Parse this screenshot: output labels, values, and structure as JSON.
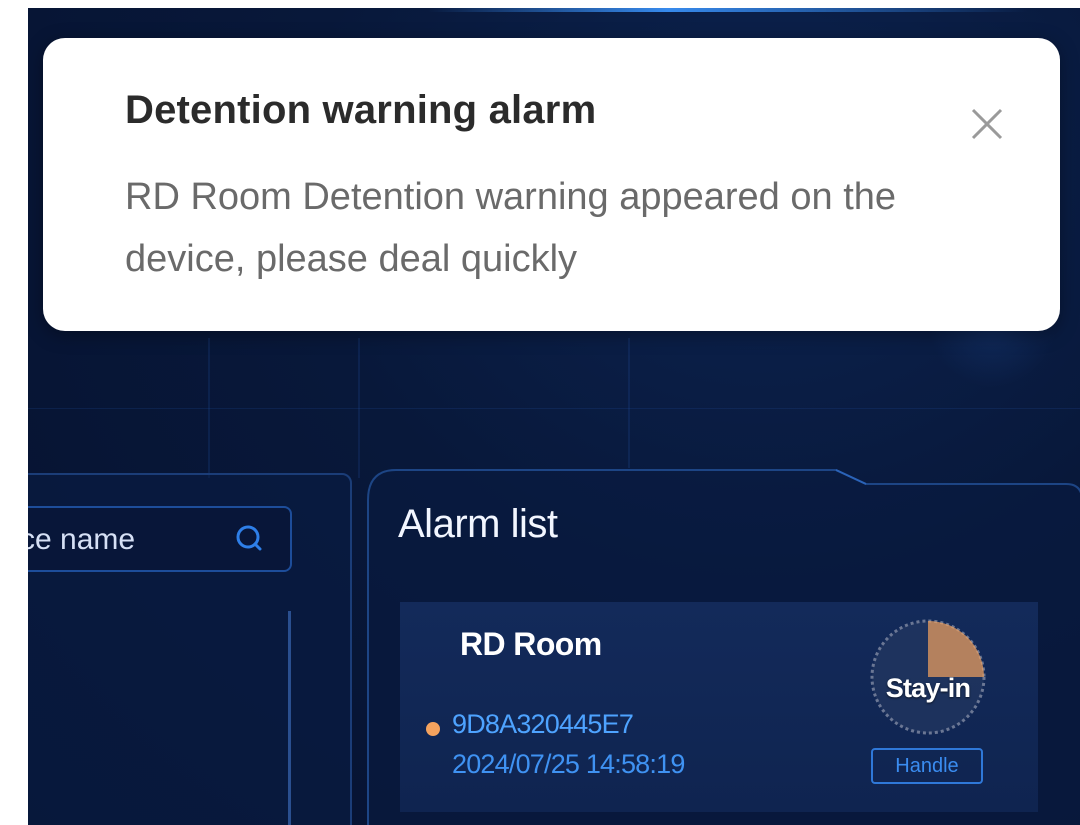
{
  "notification": {
    "title": "Detention warning alarm",
    "message": "RD Room Detention warning appeared on the device, please deal quickly",
    "close_icon": "close-icon"
  },
  "device_search": {
    "placeholder": "ce name",
    "icon": "search-icon"
  },
  "alarm_list": {
    "title": "Alarm list",
    "items": [
      {
        "room": "RD Room",
        "device_id": "9D8A320445E7",
        "timestamp": "2024/07/25 14:58:19",
        "status_label": "Stay-in",
        "status_dot_color": "#f4a25e",
        "gauge_progress": 0.25,
        "action_label": "Handle"
      }
    ]
  },
  "colors": {
    "background": "#08183a",
    "panel_border": "#1b3d78",
    "accent_blue": "#3a8cf0",
    "alert_orange": "#f4a25e"
  }
}
